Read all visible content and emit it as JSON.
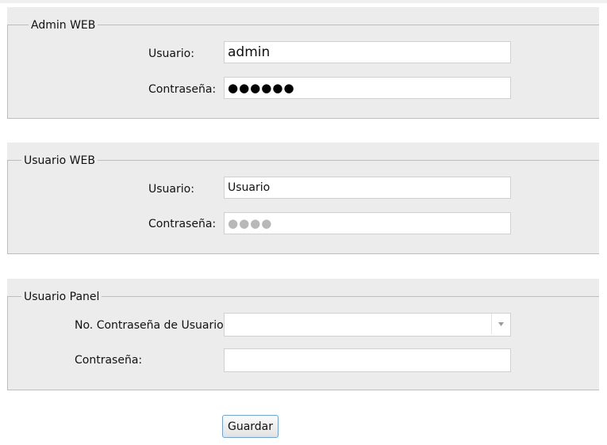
{
  "admin_web": {
    "legend": "Admin WEB",
    "user_label": "Usuario:",
    "user_value": "admin",
    "password_label": "Contraseña:",
    "password_value": "●●●●●●"
  },
  "usuario_web": {
    "legend": "Usuario WEB",
    "user_label": "Usuario:",
    "user_value": "Usuario",
    "password_label": "Contraseña:",
    "password_value": "●●●●"
  },
  "usuario_panel": {
    "legend": "Usuario Panel",
    "user_number_label": "No. Contraseña de Usuario:",
    "user_number_value": "",
    "password_label": "Contraseña:",
    "password_value": ""
  },
  "actions": {
    "save_label": "Guardar"
  }
}
